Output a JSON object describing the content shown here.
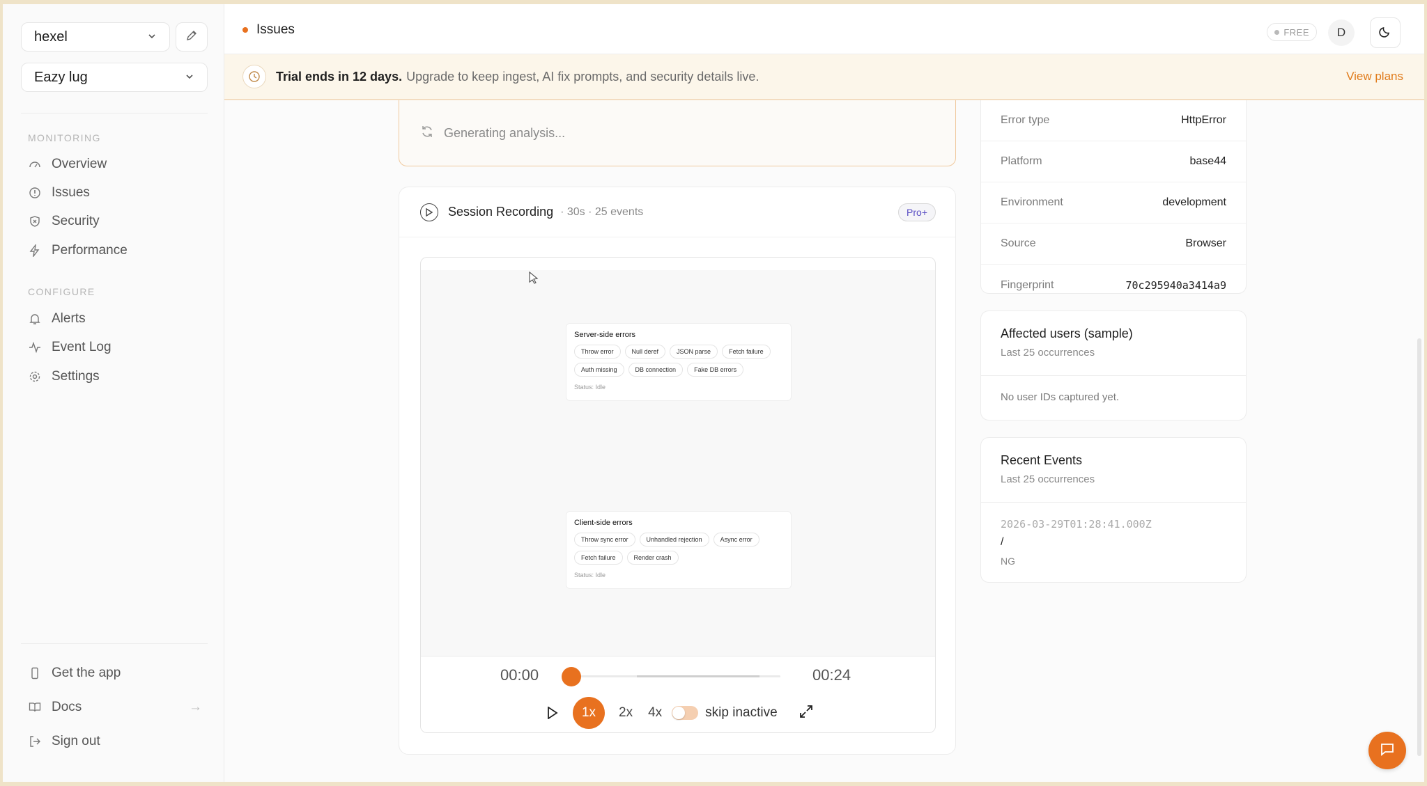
{
  "sidebar": {
    "workspace": "hexel",
    "project": "Eazy lug",
    "sections": {
      "monitoring": "MONITORING",
      "configure": "CONFIGURE"
    },
    "monitoring_items": [
      {
        "label": "Overview",
        "icon": "gauge-icon"
      },
      {
        "label": "Issues",
        "icon": "alert-circle-icon"
      },
      {
        "label": "Security",
        "icon": "shield-x-icon"
      },
      {
        "label": "Performance",
        "icon": "zap-icon"
      }
    ],
    "configure_items": [
      {
        "label": "Alerts",
        "icon": "bell-icon"
      },
      {
        "label": "Event Log",
        "icon": "activity-icon"
      },
      {
        "label": "Settings",
        "icon": "gear-icon"
      }
    ],
    "footer_items": [
      {
        "label": "Get the app",
        "icon": "smartphone-icon"
      },
      {
        "label": "Docs",
        "icon": "book-icon"
      },
      {
        "label": "Sign out",
        "icon": "log-out-icon"
      }
    ]
  },
  "header": {
    "breadcrumb": "Issues",
    "plan": "FREE",
    "avatar_initial": "D"
  },
  "banner": {
    "strong": "Trial ends in 12 days.",
    "message": "Upgrade to keep ingest, AI fix prompts, and security details live.",
    "cta": "View plans"
  },
  "analysis": {
    "status": "Generating analysis..."
  },
  "session": {
    "title": "Session Recording",
    "meta": "· 30s · 25 events",
    "badge": "Pro+",
    "replay": {
      "server_card": {
        "title": "Server-side errors",
        "chips": [
          "Throw error",
          "Null deref",
          "JSON parse",
          "Fetch failure",
          "Auth missing",
          "DB connection",
          "Fake DB errors"
        ],
        "status": "Status: Idle"
      },
      "client_card": {
        "title": "Client-side errors",
        "chips": [
          "Throw sync error",
          "Unhandled rejection",
          "Async error",
          "Fetch failure",
          "Render crash"
        ],
        "status": "Status: Idle"
      }
    },
    "player": {
      "current_time": "00:00",
      "total_time": "00:24",
      "progress": 0.0,
      "speeds": [
        "1x",
        "2x",
        "4x"
      ],
      "active_speed": "1x",
      "skip_inactive_label": "skip inactive",
      "skip_inactive": false
    }
  },
  "details": [
    {
      "key": "Error type",
      "value": "HttpError"
    },
    {
      "key": "Platform",
      "value": "base44"
    },
    {
      "key": "Environment",
      "value": "development"
    },
    {
      "key": "Source",
      "value": "Browser"
    },
    {
      "key": "Fingerprint",
      "value": "70c295940a3414a9"
    }
  ],
  "affected_users": {
    "title": "Affected users (sample)",
    "subtitle": "Last 25 occurrences",
    "empty": "No user IDs captured yet."
  },
  "recent_events": {
    "title": "Recent Events",
    "subtitle": "Last 25 occurrences",
    "events": [
      {
        "timestamp": "2026-03-29T01:28:41.000Z",
        "path": "/",
        "location": "NG"
      }
    ]
  },
  "colors": {
    "accent": "#e8711f",
    "banner_bg": "#fcf6ea"
  }
}
